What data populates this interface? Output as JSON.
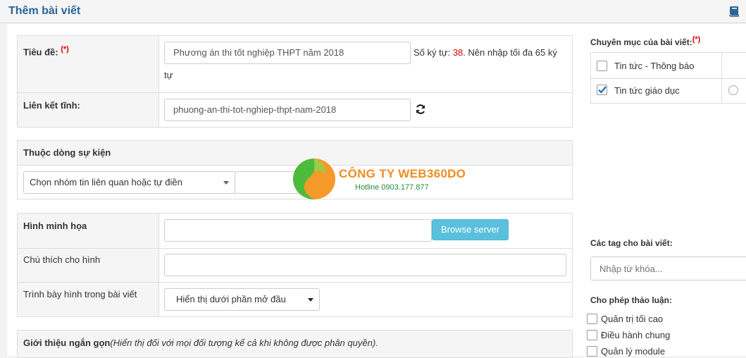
{
  "header": {
    "title": "Thêm bài viết",
    "book_icon": "book-icon"
  },
  "form": {
    "title_label": "Tiêu đề:",
    "required_mark": "(*)",
    "title_value": "Phương án thi tốt nghiệp THPT năm 2018",
    "char_count_prefix": "Số ký tự:",
    "char_count": "38",
    "char_count_suffix": ". Nên nhập tối đa 65 ký",
    "char_count_wrap": "tự",
    "alias_label": "Liên kết tĩnh:",
    "alias_value": "phuong-an-thi-tot-nghiep-thpt-nam-2018",
    "refresh_icon": "refresh-icon"
  },
  "event": {
    "label": "Thuộc dòng sự kiện",
    "select_value": "Chọn nhóm tin liên quan hoặc tự điền",
    "text_value": ""
  },
  "image": {
    "label": "Hình minh họa",
    "value": "",
    "browse_label": "Browse server",
    "caption_label": "Chú thích cho hình",
    "caption_value": "",
    "display_label": "Trình bày hình trong bài viết",
    "display_value": "Hiển thị dưới phần mở đầu"
  },
  "intro": {
    "label": "Giới thiệu ngắn gọn",
    "note": "(Hiển thị đối với mọi đối tượng kể cả khi không được phân quyền)."
  },
  "watermark": {
    "company": "CÔNG TY WEB360DO",
    "hotline": "Hotline 0903.177.877"
  },
  "sidebar": {
    "categories_label": "Chuyên mục của bài viết:",
    "required_mark": "(*)",
    "categories": [
      {
        "label": "Tin tức - Thông báo",
        "checked": false
      },
      {
        "label": "Tin tức giáo dục",
        "checked": true
      }
    ],
    "tags_label": "Các tag cho bài viết:",
    "tags_placeholder": "Nhập từ khóa...",
    "discuss_label": "Cho phép thảo luận:",
    "discuss_options": [
      {
        "label": "Quản trị tối cao"
      },
      {
        "label": "Điều hành chung"
      },
      {
        "label": "Quản lý module"
      }
    ]
  },
  "colors": {
    "accent": "#2a6496",
    "required": "#dd0000",
    "browse": "#5bc0de",
    "watermark_orange": "#f08c1e",
    "watermark_green": "#2a8a3a"
  }
}
